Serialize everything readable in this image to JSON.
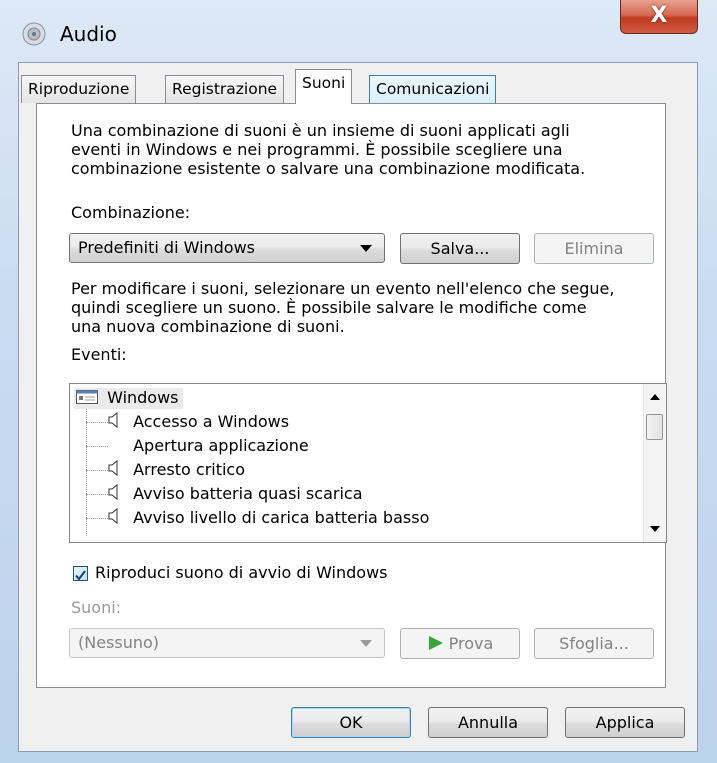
{
  "window": {
    "title": "Audio",
    "close_label": "X"
  },
  "tabs": [
    {
      "label": "Riproduzione"
    },
    {
      "label": "Registrazione"
    },
    {
      "label": "Suoni"
    },
    {
      "label": "Comunicazioni"
    }
  ],
  "panel": {
    "intro_lines": [
      "Una combinazione di suoni è un insieme di suoni applicati agli",
      "eventi in Windows e nei programmi. È possibile scegliere una",
      "combinazione esistente o salvare una combinazione modificata."
    ],
    "scheme_label": "Combinazione:",
    "scheme_value": "Predefiniti di Windows",
    "save_label": "Salva...",
    "delete_label": "Elimina",
    "edit_lines": [
      "Per modificare i suoni, selezionare un evento nell'elenco che segue,",
      "quindi scegliere un suono. È possibile salvare le modifiche come",
      "una nuova combinazione di suoni."
    ],
    "events_label": "Eventi:",
    "events": {
      "root": "Windows",
      "items": [
        {
          "label": "Accesso a Windows",
          "icon": "speaker-icon"
        },
        {
          "label": "Apertura applicazione",
          "icon": ""
        },
        {
          "label": "Arresto critico",
          "icon": "speaker-icon"
        },
        {
          "label": "Avviso batteria quasi scarica",
          "icon": "speaker-icon"
        },
        {
          "label": "Avviso livello di carica batteria basso",
          "icon": "speaker-icon"
        }
      ]
    },
    "startup_checkbox_label": "Riproduci suono di avvio di Windows",
    "startup_checked": true,
    "sounds_label": "Suoni:",
    "sounds_value": "(Nessuno)",
    "test_label": "Prova",
    "browse_label": "Sfoglia..."
  },
  "footer": {
    "ok_label": "OK",
    "cancel_label": "Annulla",
    "apply_label": "Applica"
  }
}
